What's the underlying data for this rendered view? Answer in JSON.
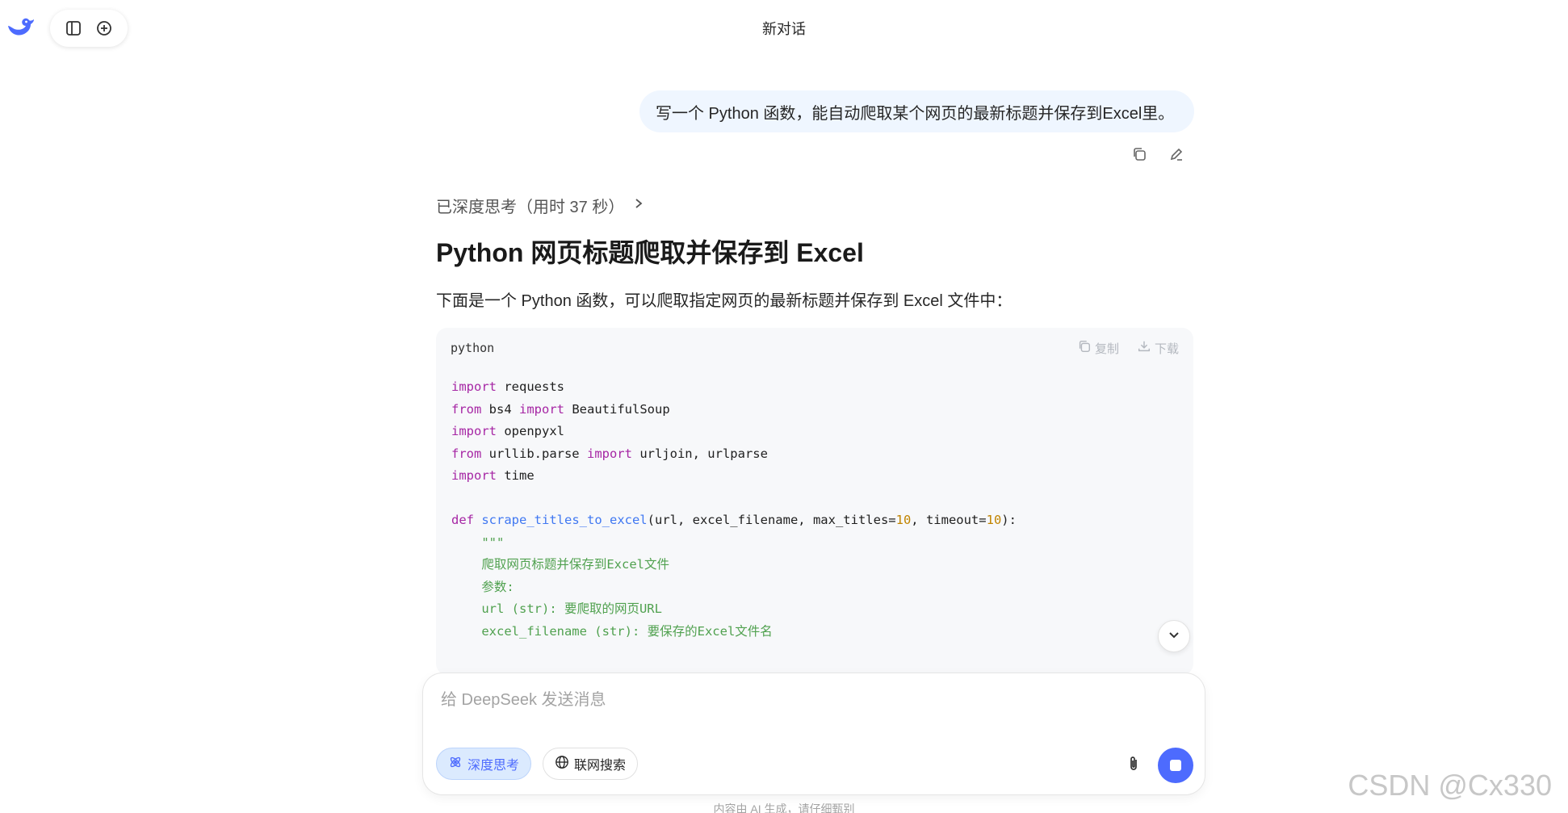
{
  "header": {
    "title": "新对话"
  },
  "user_message": {
    "text": "写一个 Python 函数，能自动爬取某个网页的最新标题并保存到Excel里。"
  },
  "thinking": {
    "label": "已深度思考（用时 37 秒）"
  },
  "answer": {
    "title": "Python 网页标题爬取并保存到 Excel",
    "intro": "下面是一个 Python 函数，可以爬取指定网页的最新标题并保存到 Excel 文件中："
  },
  "code_block": {
    "language": "python",
    "copy_label": "复制",
    "download_label": "下载",
    "lines": [
      "import requests",
      "from bs4 import BeautifulSoup",
      "import openpyxl",
      "from urllib.parse import urljoin, urlparse",
      "import time",
      "",
      "def scrape_titles_to_excel(url, excel_filename, max_titles=10, timeout=10):",
      "    \"\"\"",
      "    爬取网页标题并保存到Excel文件",
      "",
      "    参数:",
      "    url (str): 要爬取的网页URL",
      "    excel_filename (str): 要保存的Excel文件名"
    ]
  },
  "composer": {
    "placeholder": "给 DeepSeek 发送消息",
    "deep_think_label": "深度思考",
    "web_search_label": "联网搜索"
  },
  "footer": {
    "disclaimer": "内容由 AI 生成，请仔细甄别",
    "watermark": "CSDN @Cx330"
  },
  "colors": {
    "accent": "#4d6bfe",
    "bubble": "#eff6ff",
    "code_bg": "#f7f8fa"
  }
}
